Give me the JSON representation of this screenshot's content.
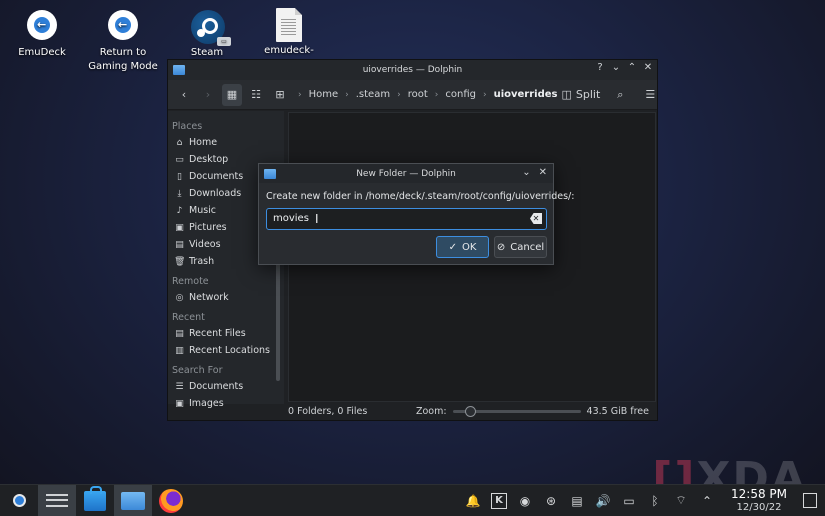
{
  "desktop": {
    "icons": [
      {
        "label": "EmuDeck"
      },
      {
        "label": "Return to Gaming Mode"
      },
      {
        "label": "Steam"
      },
      {
        "label": "emudeck-"
      }
    ]
  },
  "window": {
    "title": "uioverrides — Dolphin",
    "titlebar_buttons": [
      "?",
      "⌄",
      "⌃",
      "✕"
    ],
    "breadcrumb": [
      "Home",
      ".steam",
      "root",
      "config",
      "uioverrides"
    ],
    "split_label": "Split",
    "sidebar": {
      "sections": [
        {
          "heading": "Places",
          "items": [
            {
              "label": "Home",
              "icon": "home-icon"
            },
            {
              "label": "Desktop",
              "icon": "desktop-icon"
            },
            {
              "label": "Documents",
              "icon": "documents-icon"
            },
            {
              "label": "Downloads",
              "icon": "downloads-icon"
            },
            {
              "label": "Music",
              "icon": "music-icon"
            },
            {
              "label": "Pictures",
              "icon": "pictures-icon"
            },
            {
              "label": "Videos",
              "icon": "videos-icon"
            },
            {
              "label": "Trash",
              "icon": "trash-icon"
            }
          ]
        },
        {
          "heading": "Remote",
          "items": [
            {
              "label": "Network",
              "icon": "network-icon"
            }
          ]
        },
        {
          "heading": "Recent",
          "items": [
            {
              "label": "Recent Files",
              "icon": "recent-files-icon"
            },
            {
              "label": "Recent Locations",
              "icon": "recent-locations-icon"
            }
          ]
        },
        {
          "heading": "Search For",
          "items": [
            {
              "label": "Documents",
              "icon": "documents-icon"
            },
            {
              "label": "Images",
              "icon": "images-icon"
            }
          ]
        }
      ]
    },
    "status": {
      "counts": "0 Folders, 0 Files",
      "zoom_label": "Zoom:",
      "zoom_level": 0.1,
      "free_space": "43.5 GiB free"
    }
  },
  "dialog": {
    "title": "New Folder — Dolphin",
    "prompt": "Create new folder in /home/deck/.steam/root/config/uioverrides/:",
    "input_value": "movies",
    "ok_label": "OK",
    "cancel_label": "Cancel"
  },
  "taskbar": {
    "time": "12:58 PM",
    "date": "12/30/22"
  },
  "watermark": {
    "text": "XDA"
  },
  "colors": {
    "accent": "#3d8ee0",
    "window_bg": "#1f2124",
    "desktop_bg": "#1c2444"
  }
}
